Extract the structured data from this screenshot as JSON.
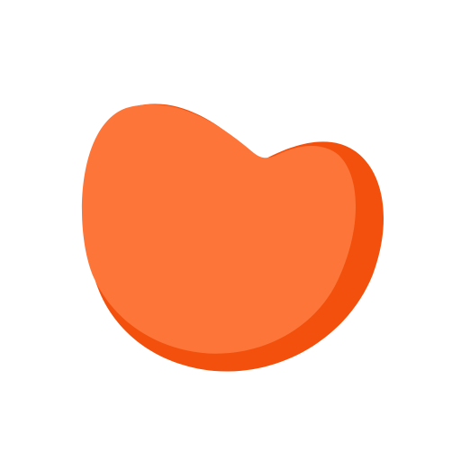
{
  "logo": {
    "icon": "bean-shape-logo-icon",
    "colors": {
      "background": "#ffffff",
      "face": "#FD7538",
      "shadow": "#F2500C"
    }
  }
}
